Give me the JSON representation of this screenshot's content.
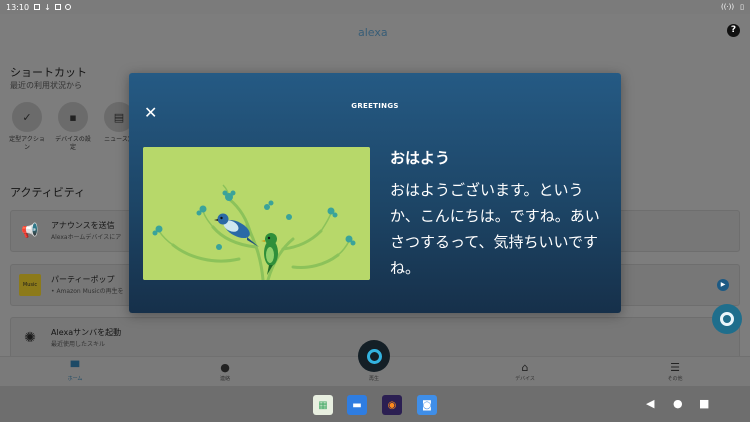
{
  "statusbar": {
    "time": "13:10"
  },
  "app": {
    "logo": "alexa",
    "help": "?",
    "shortcuts_title": "ショートカット",
    "shortcuts_sub": "最近の利用状況から",
    "shortcuts": [
      {
        "label": "定型アクション",
        "icon": "check-clock-icon"
      },
      {
        "label": "デバイスの設定",
        "icon": "devices-icon"
      },
      {
        "label": "ニュース定",
        "icon": "news-icon"
      }
    ],
    "activity_title": "アクティビティ",
    "cards": [
      {
        "title": "アナウンスを送信",
        "subtitle": "Alexaホームデバイスにア",
        "icon": "megaphone-icon"
      },
      {
        "title": "パーティーポップ",
        "subtitle": "• Amazon Musicの再生を",
        "icon": "music-thumbnail",
        "thumb": "Music"
      },
      {
        "title": "Alexaサンバを起動",
        "subtitle": "最近使用したスキル",
        "icon": "skill-icon"
      }
    ]
  },
  "tabs": [
    {
      "label": "ホーム",
      "icon": "home-icon"
    },
    {
      "label": "連絡",
      "icon": "chat-icon"
    },
    {
      "label": "再生",
      "icon": "play-icon"
    },
    {
      "label": "デバイス",
      "icon": "devices-icon"
    },
    {
      "label": "その他",
      "icon": "menu-icon"
    }
  ],
  "modal": {
    "title": "GREETINGS",
    "heading": "おはよう",
    "body": "おはようございます。というか、こんにちは。ですね。あいさつするって、気持ちいいですね。"
  },
  "colors": {
    "modal_top": "#255a84",
    "modal_bottom": "#16304a",
    "illustration_bg": "#b7d86a",
    "accent": "#33b3e0"
  }
}
